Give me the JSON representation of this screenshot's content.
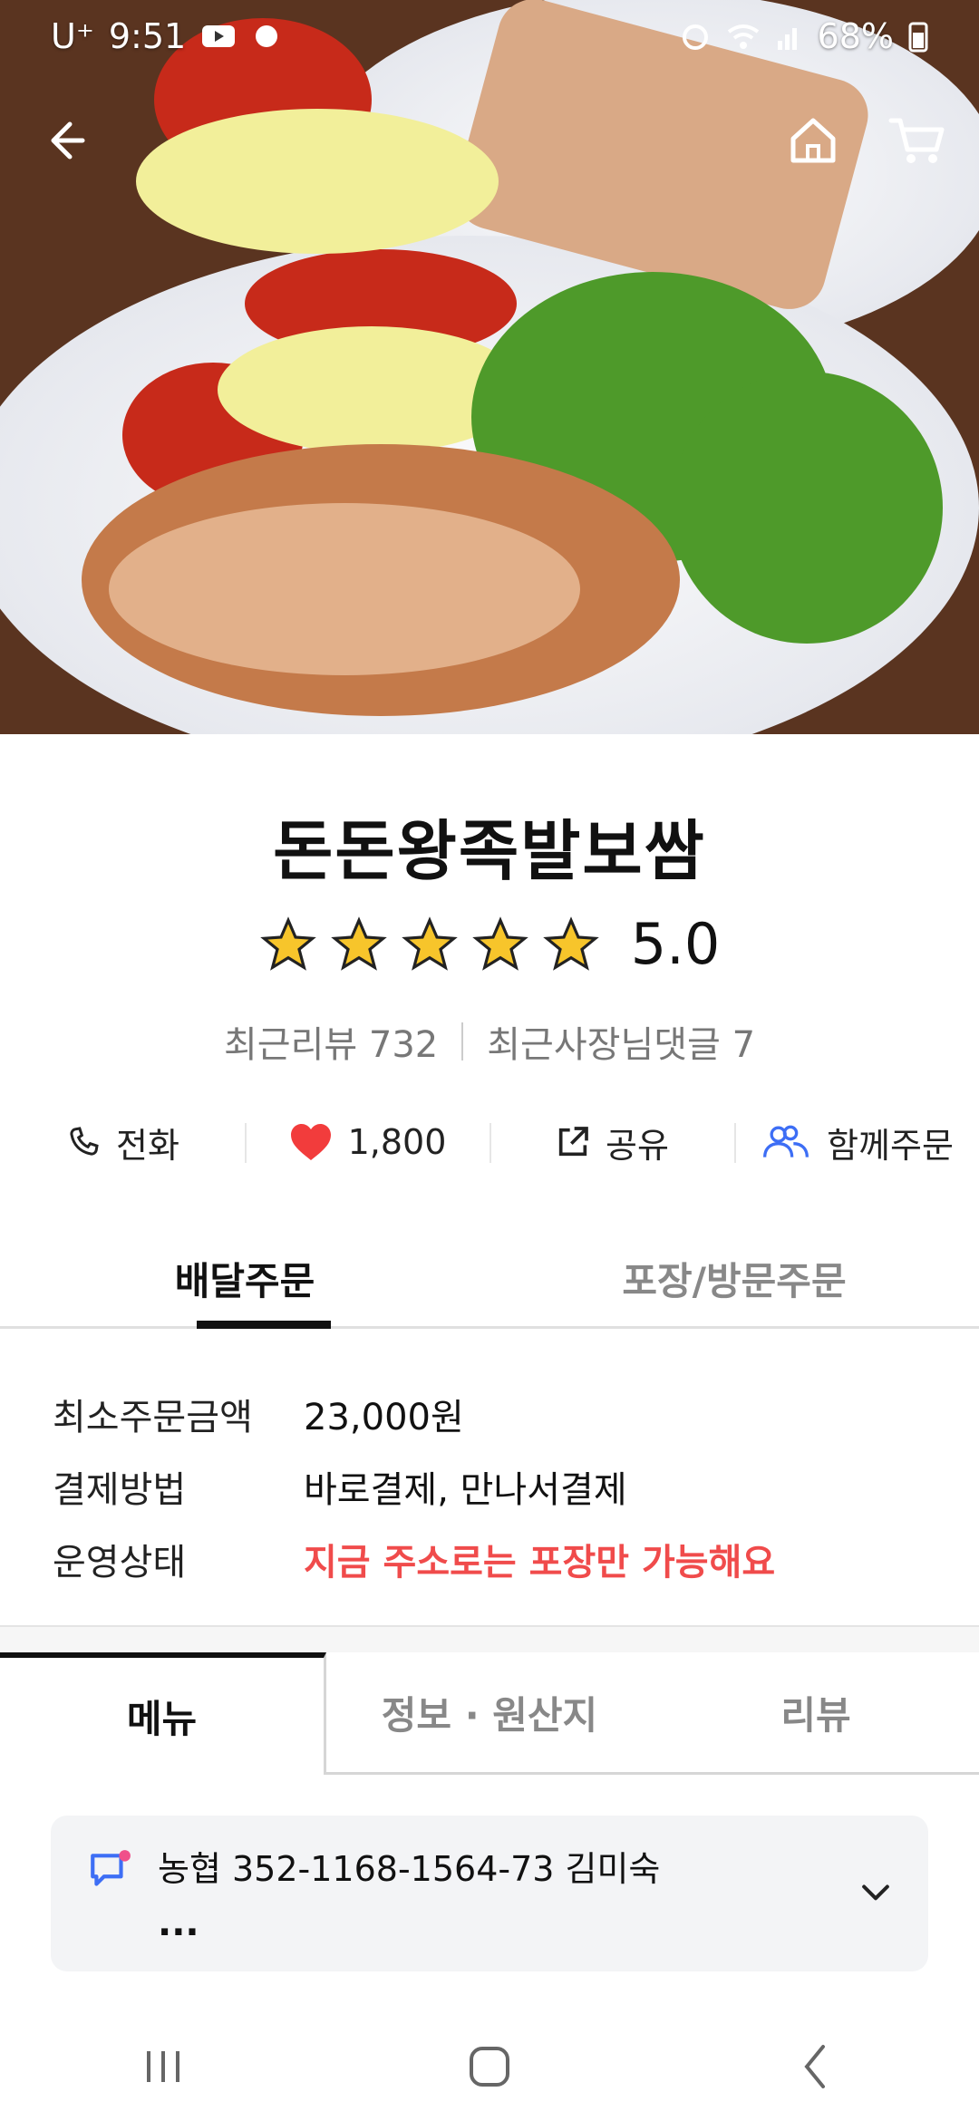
{
  "status_bar": {
    "carrier": "U⁺",
    "time": "9:51",
    "battery": "68%"
  },
  "store": {
    "name": "돈돈왕족발보쌈",
    "rating": "5.0",
    "stars_filled": 5,
    "recent_reviews": "최근리뷰 732",
    "owner_replies": "최근사장님댓글 7"
  },
  "actions": {
    "call": "전화",
    "likes": "1,800",
    "share": "공유",
    "group_order": "함께주문"
  },
  "order_tabs": {
    "delivery": "배달주문",
    "pickup": "포장/방문주문",
    "active": "delivery"
  },
  "info": {
    "min_order_label": "최소주문금액",
    "min_order_value": "23,000원",
    "payment_label": "결제방법",
    "payment_value": "바로결제, 만나서결제",
    "status_label": "운영상태",
    "status_value": "지금 주소로는 포장만 가능해요"
  },
  "content_tabs": {
    "menu": "메뉴",
    "info": "정보 · 원산지",
    "review": "리뷰",
    "active": "menu"
  },
  "notice": {
    "text": "농협 352-1168-1564-73 김미숙",
    "more": "..."
  },
  "colors": {
    "accent_red": "#f04b4b",
    "heart": "#f23c3c",
    "star": "#f7c52b",
    "group_blue": "#3d6ef5"
  }
}
